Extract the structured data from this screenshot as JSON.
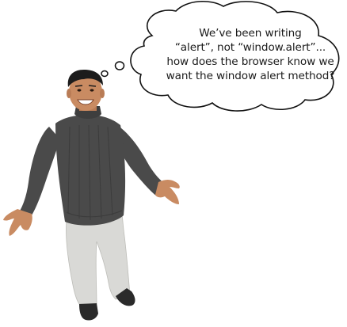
{
  "thought_bubble": {
    "lines": [
      "We’ve been writing",
      "“alert”, not “window.alert”...",
      "how does the browser know we",
      "want the window alert method?"
    ]
  },
  "figure": {
    "description_icon": "shrugging-man-icon",
    "colors": {
      "sweater": "#4a4a4a",
      "pants": "#d9d9d6",
      "skin": "#c98b62",
      "hair": "#1c1c1c",
      "shoes": "#2a2a2a"
    }
  }
}
